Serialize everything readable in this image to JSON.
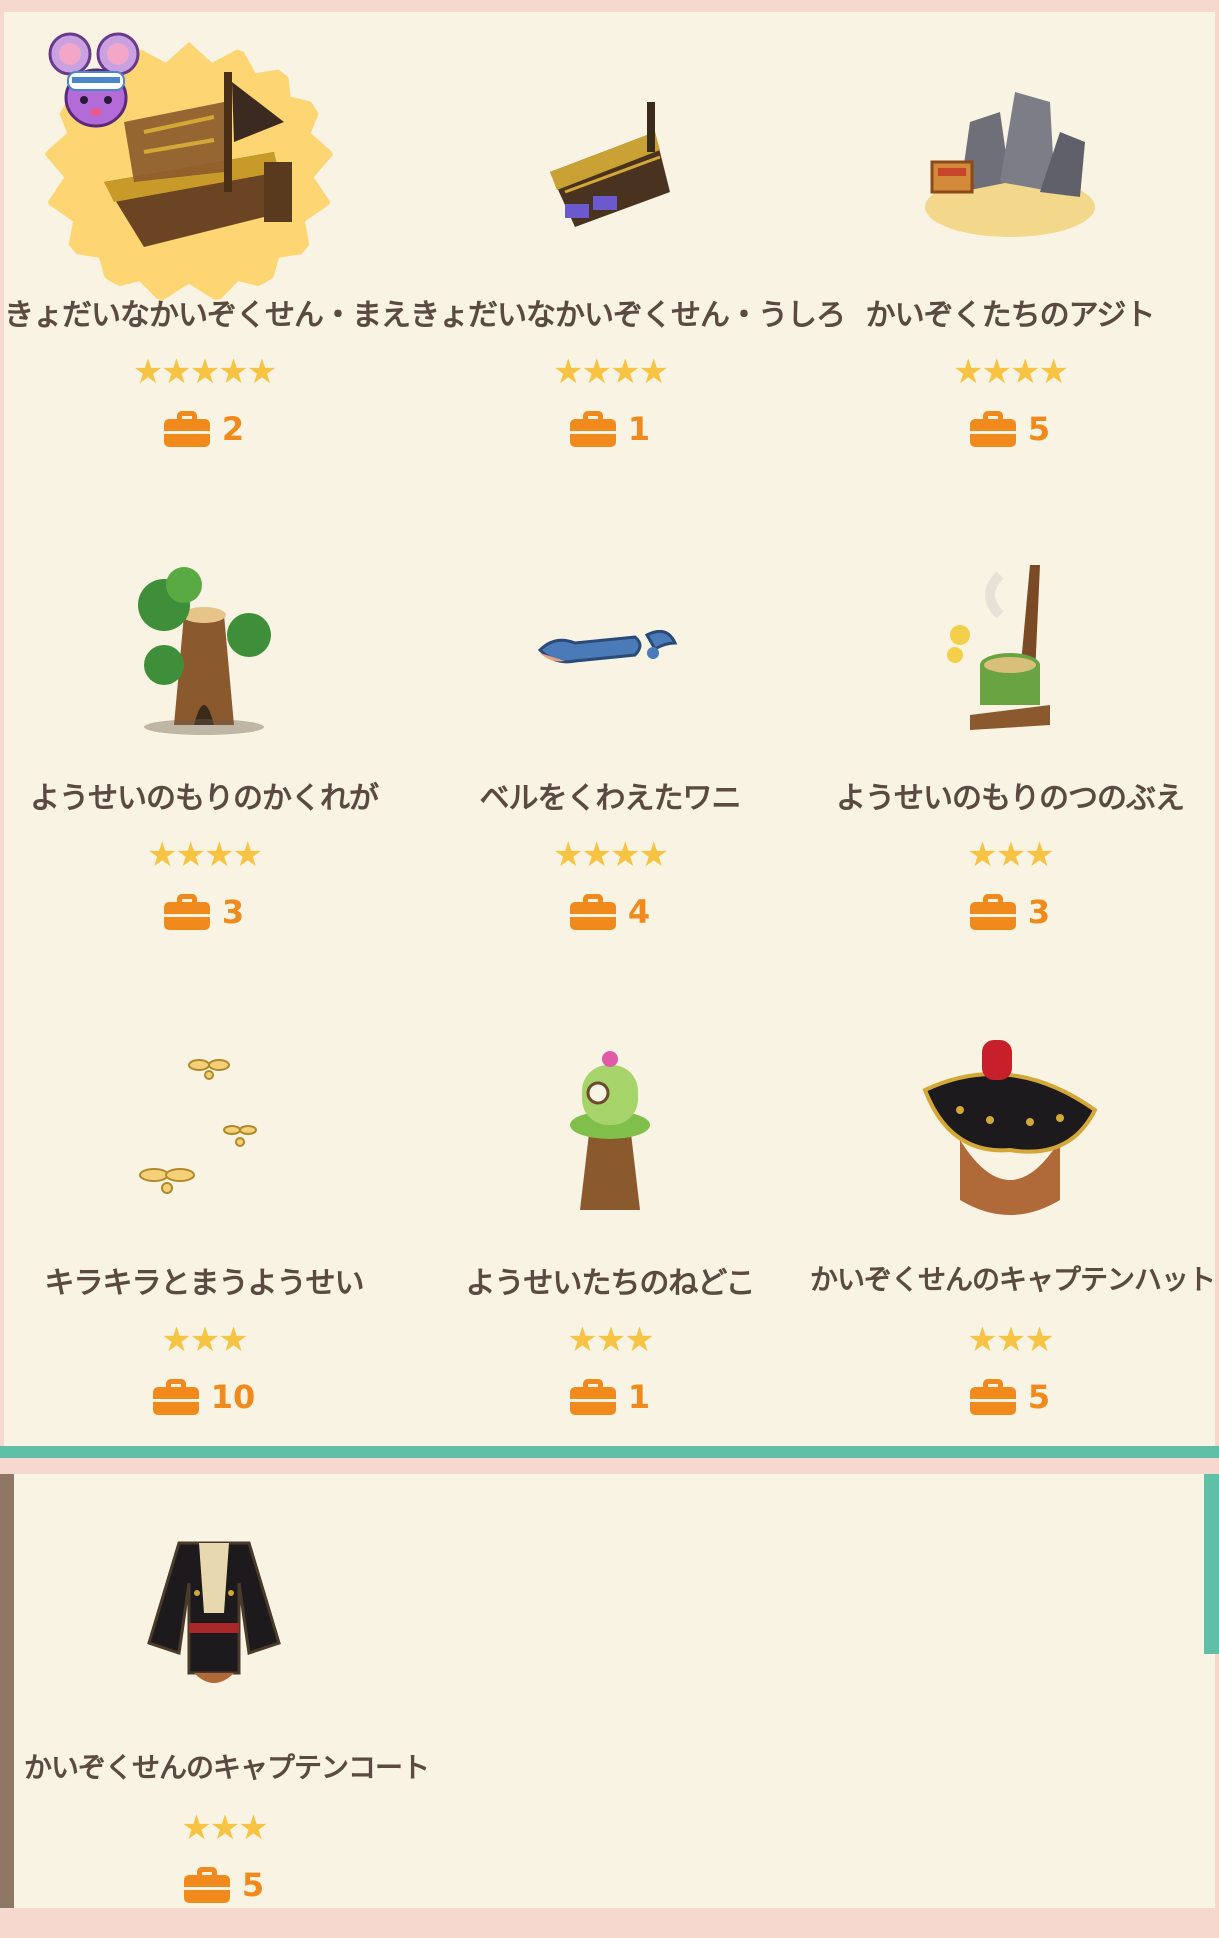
{
  "items": [
    {
      "name": "きょだいなかいぞくせん・まえ",
      "stars": "★★★★★",
      "count": "2",
      "icon": "pirate-ship-front-icon"
    },
    {
      "name": "きょだいなかいぞくせん・うしろ",
      "stars": "★★★★",
      "count": "1",
      "icon": "pirate-ship-back-icon"
    },
    {
      "name": "かいぞくたちのアジト",
      "stars": "★★★★",
      "count": "5",
      "icon": "pirate-hideout-icon"
    },
    {
      "name": "ようせいのもりのかくれが",
      "stars": "★★★★",
      "count": "3",
      "icon": "fairy-forest-hideout-icon"
    },
    {
      "name": "ベルをくわえたワニ",
      "stars": "★★★★",
      "count": "4",
      "icon": "crocodile-icon"
    },
    {
      "name": "ようせいのもりのつのぶえ",
      "stars": "★★★",
      "count": "3",
      "icon": "fairy-forest-horn-icon"
    },
    {
      "name": "キラキラとまうようせい",
      "stars": "★★★",
      "count": "10",
      "icon": "sparkling-fairies-icon"
    },
    {
      "name": "ようせいたちのねどこ",
      "stars": "★★★",
      "count": "1",
      "icon": "fairy-bed-icon"
    },
    {
      "name": "かいぞくせんのキャプテンハット",
      "stars": "★★★",
      "count": "5",
      "icon": "captain-hat-icon"
    },
    {
      "name": "かいぞくせんのキャプテンコート",
      "stars": "★★★",
      "count": "5",
      "icon": "captain-coat-icon"
    }
  ],
  "colors": {
    "star": "#f6c342",
    "count": "#f08a1c",
    "panel": "#f8f3e2",
    "accent": "#5fbfa7"
  }
}
